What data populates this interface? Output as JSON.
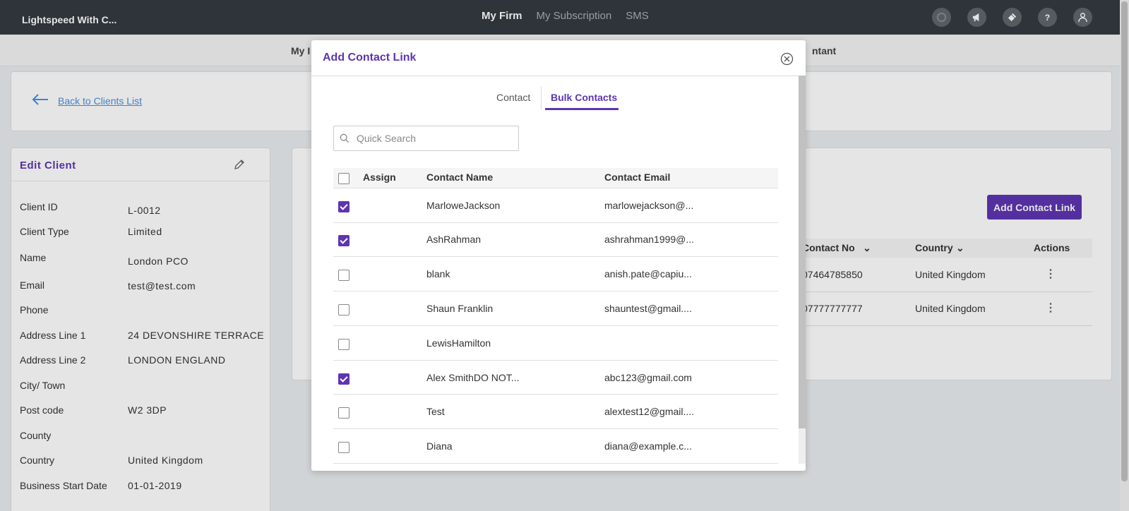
{
  "app": {
    "brand": "Lightspeed With C..."
  },
  "topnav": [
    "My Firm",
    "My Subscription",
    "SMS"
  ],
  "subnav": {
    "left_fragment": "My I",
    "right_fragment": "ntant"
  },
  "back": {
    "label": "Back to Clients List"
  },
  "edit_client": {
    "title": "Edit Client",
    "fields": [
      {
        "label": "Client ID",
        "value": "L-0012"
      },
      {
        "label": "Client Type",
        "value": "Limited"
      },
      {
        "label": "Name",
        "value": "London PCO"
      },
      {
        "label": "Email",
        "value": "test@test.com"
      },
      {
        "label": "Phone",
        "value": ""
      },
      {
        "label": "Address Line 1",
        "value": "24 DEVONSHIRE TERRACE"
      },
      {
        "label": "Address Line 2",
        "value": "LONDON ENGLAND"
      },
      {
        "label": "City/ Town",
        "value": ""
      },
      {
        "label": "Post code",
        "value": "W2 3DP"
      },
      {
        "label": "County",
        "value": ""
      },
      {
        "label": "Country",
        "value": "United Kingdom"
      },
      {
        "label": "Business Start Date",
        "value": "01-01-2019"
      }
    ]
  },
  "contacts_panel": {
    "add_button": "Add Contact Link",
    "columns": [
      "Contact No",
      "Country",
      "Actions"
    ],
    "rows": [
      {
        "contact_no": "07464785850",
        "country": "United Kingdom"
      },
      {
        "contact_no": "07777777777",
        "country": "United Kingdom"
      }
    ]
  },
  "modal": {
    "title": "Add Contact Link",
    "tabs": [
      "Contact",
      "Bulk Contacts"
    ],
    "active_tab": "Bulk Contacts",
    "search_placeholder": "Quick Search",
    "columns": [
      "Assign",
      "Contact Name",
      "Contact Email"
    ],
    "rows": [
      {
        "checked": true,
        "name": "MarloweJackson",
        "email": "marlowejackson@..."
      },
      {
        "checked": true,
        "name": "AshRahman",
        "email": "ashrahman1999@..."
      },
      {
        "checked": false,
        "name": "blank",
        "email": "anish.pate@capiu..."
      },
      {
        "checked": false,
        "name": "Shaun Franklin",
        "email": "shauntest@gmail...."
      },
      {
        "checked": false,
        "name": "LewisHamilton",
        "email": ""
      },
      {
        "checked": true,
        "name": "Alex SmithDO NOT...",
        "email": "abc123@gmail.com"
      },
      {
        "checked": false,
        "name": "Test",
        "email": "alextest12@gmail...."
      },
      {
        "checked": false,
        "name": "Diana",
        "email": "diana@example.c..."
      }
    ]
  },
  "colors": {
    "accent": "#5e35b1",
    "topbar": "#343a40",
    "link": "#4a90e2"
  }
}
